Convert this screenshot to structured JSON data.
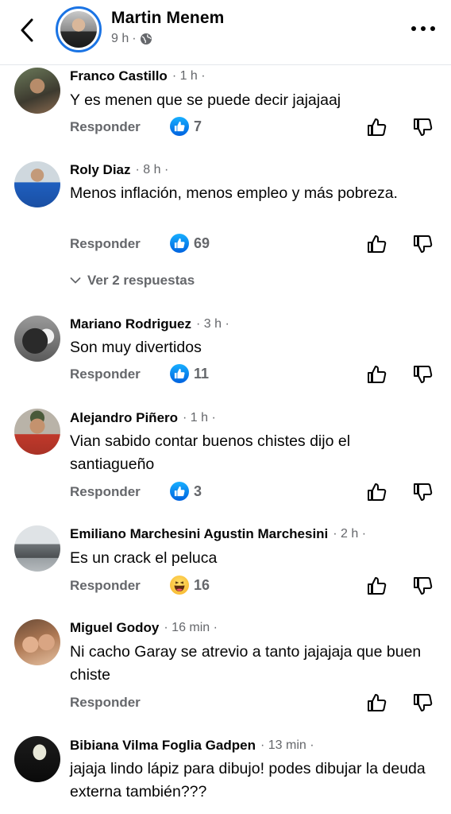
{
  "header": {
    "name": "Martin Menem",
    "time": "9 h",
    "dot": "·"
  },
  "comments": [
    {
      "name": "Franco Castillo",
      "meta": "· 1 h ·",
      "text": "Y es menen que se puede decir jajajaaj",
      "reply": "Responder",
      "reaction": "like",
      "count": "7"
    },
    {
      "name": "Roly Diaz",
      "meta": "· 8 h ·",
      "text": "Menos inflación,  menos empleo y más pobreza.",
      "reply": "Responder",
      "reaction": "like",
      "count": "69"
    },
    {
      "name": "Mariano Rodriguez",
      "meta": "· 3 h ·",
      "text": "Son muy divertidos",
      "reply": "Responder",
      "reaction": "like",
      "count": "11"
    },
    {
      "name": "Alejandro Piñero",
      "meta": "· 1 h ·",
      "text": "Vian sabido contar buenos chistes dijo el santiagueño",
      "reply": "Responder",
      "reaction": "like",
      "count": "3"
    },
    {
      "name": "Emiliano Marchesini Agustin Marchesini",
      "meta": "· 2 h ·",
      "text": "Es un crack el peluca",
      "reply": "Responder",
      "reaction": "haha",
      "count": "16"
    },
    {
      "name": "Miguel Godoy",
      "meta": "· 16 min ·",
      "text": "Ni cacho Garay se atrevio a tanto jajajaja que buen chiste",
      "reply": "Responder",
      "reaction": "",
      "count": ""
    },
    {
      "name": "Bibiana Vilma Foglia Gadpen",
      "meta": "· 13 min ·",
      "text": "jajaja lindo lápiz para dibujo! podes dibujar la deuda externa también???",
      "reply": "",
      "reaction": "",
      "count": ""
    }
  ],
  "view_replies": "Ver 2 respuestas",
  "icons": {
    "back": "chevron-left-icon",
    "more": "more-horizontal-icon",
    "globe": "globe-icon",
    "like": "thumbs-up-icon",
    "dislike": "thumbs-down-icon"
  },
  "colors": {
    "accent": "#1b74e4",
    "muted": "#65676b"
  }
}
